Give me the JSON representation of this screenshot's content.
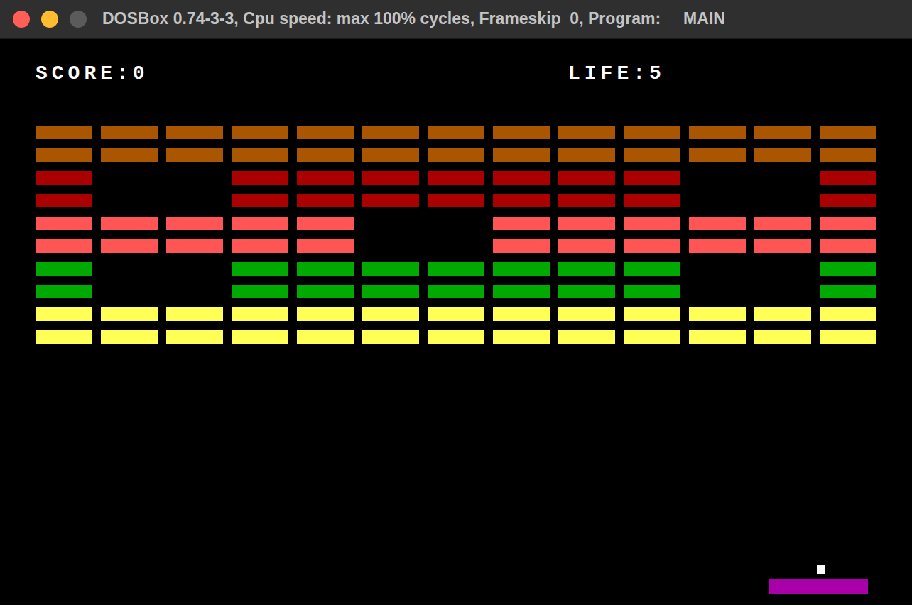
{
  "window": {
    "title": "DOSBox 0.74-3-3, Cpu speed: max 100% cycles, Frameskip  0, Program:     MAIN"
  },
  "hud": {
    "score_label": "SCORE:",
    "score": "0",
    "life_label": "LIFE:",
    "life": "5"
  },
  "bricks": {
    "rows": [
      {
        "color": "#aa5500",
        "cells": [
          {
            "broken": false
          },
          {
            "broken": false
          },
          {
            "broken": false
          },
          {
            "broken": false
          },
          {
            "broken": false
          },
          {
            "broken": false
          },
          {
            "broken": false
          },
          {
            "broken": false
          },
          {
            "broken": false
          },
          {
            "broken": false
          },
          {
            "broken": false
          },
          {
            "broken": false
          },
          {
            "broken": false
          }
        ]
      },
      {
        "color": "#aa5500",
        "cells": [
          {
            "broken": false
          },
          {
            "broken": false
          },
          {
            "broken": false
          },
          {
            "broken": false
          },
          {
            "broken": false
          },
          {
            "broken": false
          },
          {
            "broken": false
          },
          {
            "broken": false
          },
          {
            "broken": false
          },
          {
            "broken": false
          },
          {
            "broken": false
          },
          {
            "broken": false
          },
          {
            "broken": false
          }
        ]
      },
      {
        "color": "#aa0000",
        "cells": [
          {
            "broken": false
          },
          {
            "broken": true
          },
          {
            "broken": true
          },
          {
            "broken": false
          },
          {
            "broken": false
          },
          {
            "broken": false
          },
          {
            "broken": false
          },
          {
            "broken": false
          },
          {
            "broken": false
          },
          {
            "broken": false
          },
          {
            "broken": true
          },
          {
            "broken": true
          },
          {
            "broken": false
          }
        ]
      },
      {
        "color": "#aa0000",
        "cells": [
          {
            "broken": false
          },
          {
            "broken": true
          },
          {
            "broken": true
          },
          {
            "broken": false
          },
          {
            "broken": false
          },
          {
            "broken": false
          },
          {
            "broken": false
          },
          {
            "broken": false
          },
          {
            "broken": false
          },
          {
            "broken": false
          },
          {
            "broken": true
          },
          {
            "broken": true
          },
          {
            "broken": false
          }
        ]
      },
      {
        "color": "#ff5555",
        "cells": [
          {
            "broken": false
          },
          {
            "broken": false
          },
          {
            "broken": false
          },
          {
            "broken": false
          },
          {
            "broken": false
          },
          {
            "broken": true
          },
          {
            "broken": true
          },
          {
            "broken": false
          },
          {
            "broken": false
          },
          {
            "broken": false
          },
          {
            "broken": false
          },
          {
            "broken": false
          },
          {
            "broken": false
          }
        ]
      },
      {
        "color": "#ff5555",
        "cells": [
          {
            "broken": false
          },
          {
            "broken": false
          },
          {
            "broken": false
          },
          {
            "broken": false
          },
          {
            "broken": false
          },
          {
            "broken": true
          },
          {
            "broken": true
          },
          {
            "broken": false
          },
          {
            "broken": false
          },
          {
            "broken": false
          },
          {
            "broken": false
          },
          {
            "broken": false
          },
          {
            "broken": false
          }
        ]
      },
      {
        "color": "#00aa00",
        "cells": [
          {
            "broken": false
          },
          {
            "broken": true
          },
          {
            "broken": true
          },
          {
            "broken": false
          },
          {
            "broken": false
          },
          {
            "broken": false
          },
          {
            "broken": false
          },
          {
            "broken": false
          },
          {
            "broken": false
          },
          {
            "broken": false
          },
          {
            "broken": true
          },
          {
            "broken": true
          },
          {
            "broken": false
          }
        ]
      },
      {
        "color": "#00aa00",
        "cells": [
          {
            "broken": false
          },
          {
            "broken": true
          },
          {
            "broken": true
          },
          {
            "broken": false
          },
          {
            "broken": false
          },
          {
            "broken": false
          },
          {
            "broken": false
          },
          {
            "broken": false
          },
          {
            "broken": false
          },
          {
            "broken": false
          },
          {
            "broken": true
          },
          {
            "broken": true
          },
          {
            "broken": false
          }
        ]
      },
      {
        "color": "#ffff55",
        "cells": [
          {
            "broken": false
          },
          {
            "broken": false
          },
          {
            "broken": false
          },
          {
            "broken": false
          },
          {
            "broken": false
          },
          {
            "broken": false
          },
          {
            "broken": false
          },
          {
            "broken": false
          },
          {
            "broken": false
          },
          {
            "broken": false
          },
          {
            "broken": false
          },
          {
            "broken": false
          },
          {
            "broken": false
          }
        ]
      },
      {
        "color": "#ffff55",
        "cells": [
          {
            "broken": false
          },
          {
            "broken": false
          },
          {
            "broken": false
          },
          {
            "broken": false
          },
          {
            "broken": false
          },
          {
            "broken": false
          },
          {
            "broken": false
          },
          {
            "broken": false
          },
          {
            "broken": false
          },
          {
            "broken": false
          },
          {
            "broken": false
          },
          {
            "broken": false
          },
          {
            "broken": false
          }
        ]
      }
    ]
  }
}
